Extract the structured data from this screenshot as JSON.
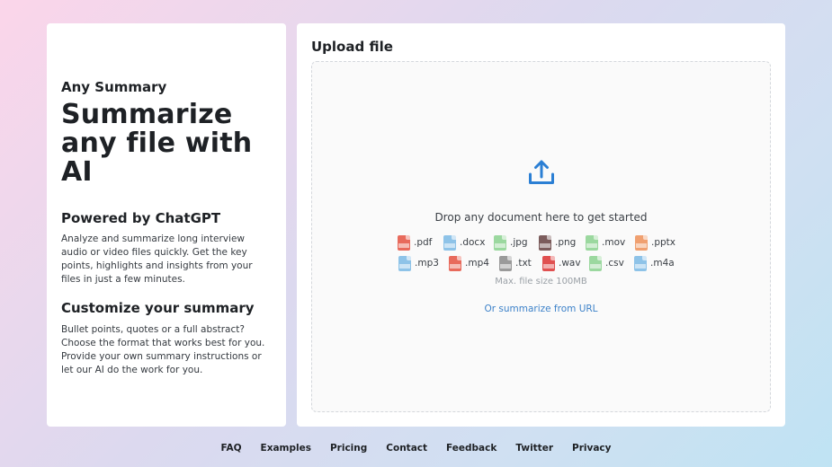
{
  "left": {
    "brand": "Any Summary",
    "headline": "Summarize any file with AI",
    "sections": [
      {
        "title": "Powered by ChatGPT",
        "text": "Analyze and summarize long interview audio or video files quickly. Get the key points, highlights and insights from your files in just a few minutes."
      },
      {
        "title": "Customize your summary",
        "text": "Bullet points, quotes or a full abstract? Choose the format that works best for you. Provide your own summary instructions or let our AI do the work for you."
      }
    ]
  },
  "upload": {
    "title": "Upload file",
    "icon": "upload-icon",
    "accent_color": "#2b7fd4",
    "drop_text": "Drop any document here to get started",
    "file_types_row1": [
      {
        "label": ".pdf",
        "icon": "pdf-file-icon",
        "color": "#e86a5c"
      },
      {
        "label": ".docx",
        "icon": "docx-file-icon",
        "color": "#8ec3e8"
      },
      {
        "label": ".jpg",
        "icon": "jpg-file-icon",
        "color": "#9bd89f"
      },
      {
        "label": ".png",
        "icon": "png-file-icon",
        "color": "#7b5c5c"
      },
      {
        "label": ".mov",
        "icon": "mov-file-icon",
        "color": "#9bd89f"
      },
      {
        "label": ".pptx",
        "icon": "pptx-file-icon",
        "color": "#f0a070"
      }
    ],
    "file_types_row2": [
      {
        "label": ".mp3",
        "icon": "mp3-file-icon",
        "color": "#8ec3e8"
      },
      {
        "label": ".mp4",
        "icon": "mp4-file-icon",
        "color": "#e86a5c"
      },
      {
        "label": ".txt",
        "icon": "txt-file-icon",
        "color": "#9a9a9a"
      },
      {
        "label": ".wav",
        "icon": "wav-file-icon",
        "color": "#e05050"
      },
      {
        "label": ".csv",
        "icon": "csv-file-icon",
        "color": "#9bd89f"
      },
      {
        "label": ".m4a",
        "icon": "m4a-file-icon",
        "color": "#8ec3e8"
      }
    ],
    "max_size": "Max. file size 100MB",
    "url_link": "Or summarize from URL"
  },
  "footer": {
    "links": [
      "FAQ",
      "Examples",
      "Pricing",
      "Contact",
      "Feedback",
      "Twitter",
      "Privacy"
    ]
  }
}
